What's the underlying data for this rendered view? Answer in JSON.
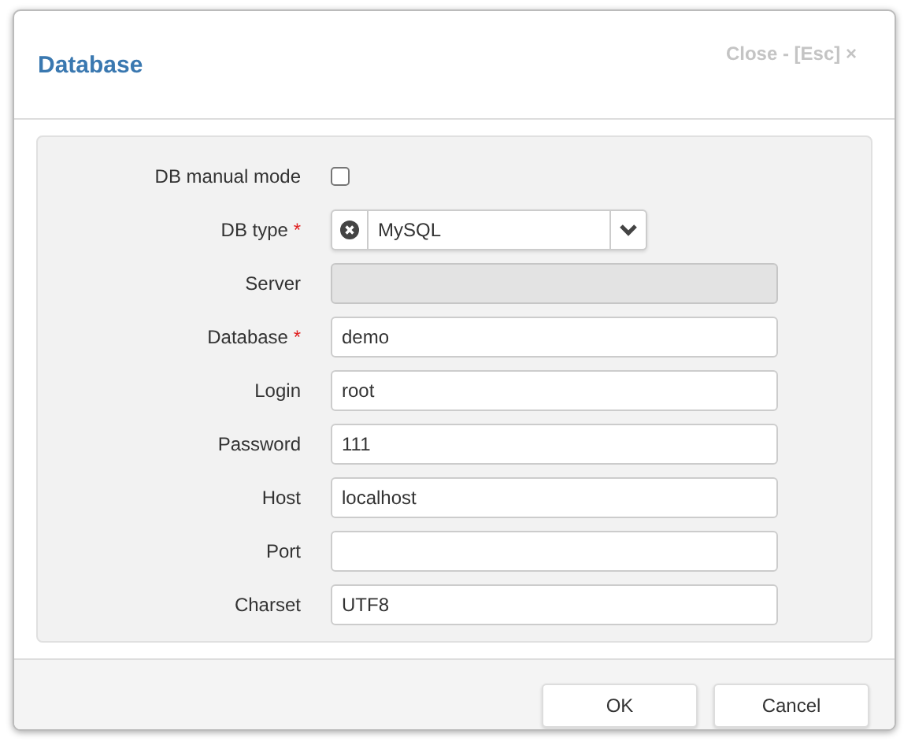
{
  "dialog": {
    "title": "Database",
    "close_label": "Close - [Esc] ×"
  },
  "required_mark": "*",
  "fields": [
    {
      "kind": "checkbox",
      "label": "DB manual mode",
      "required": false,
      "checked": false
    },
    {
      "kind": "select",
      "label": "DB type",
      "required": true,
      "value": "MySQL"
    },
    {
      "kind": "text",
      "label": "Server",
      "required": false,
      "disabled": true
    },
    {
      "kind": "text",
      "label": "Database",
      "required": true,
      "disabled": false,
      "value": "demo"
    },
    {
      "kind": "text",
      "label": "Login",
      "required": false,
      "disabled": false,
      "value": "root"
    },
    {
      "kind": "text",
      "label": "Password",
      "required": false,
      "disabled": false,
      "value": "111"
    },
    {
      "kind": "text",
      "label": "Host",
      "required": false,
      "disabled": false,
      "value": "localhost"
    },
    {
      "kind": "text",
      "label": "Port",
      "required": false,
      "disabled": false
    },
    {
      "kind": "text",
      "label": "Charset",
      "required": false,
      "disabled": false,
      "value": "UTF8"
    }
  ],
  "buttons": [
    "OK",
    "Cancel"
  ]
}
